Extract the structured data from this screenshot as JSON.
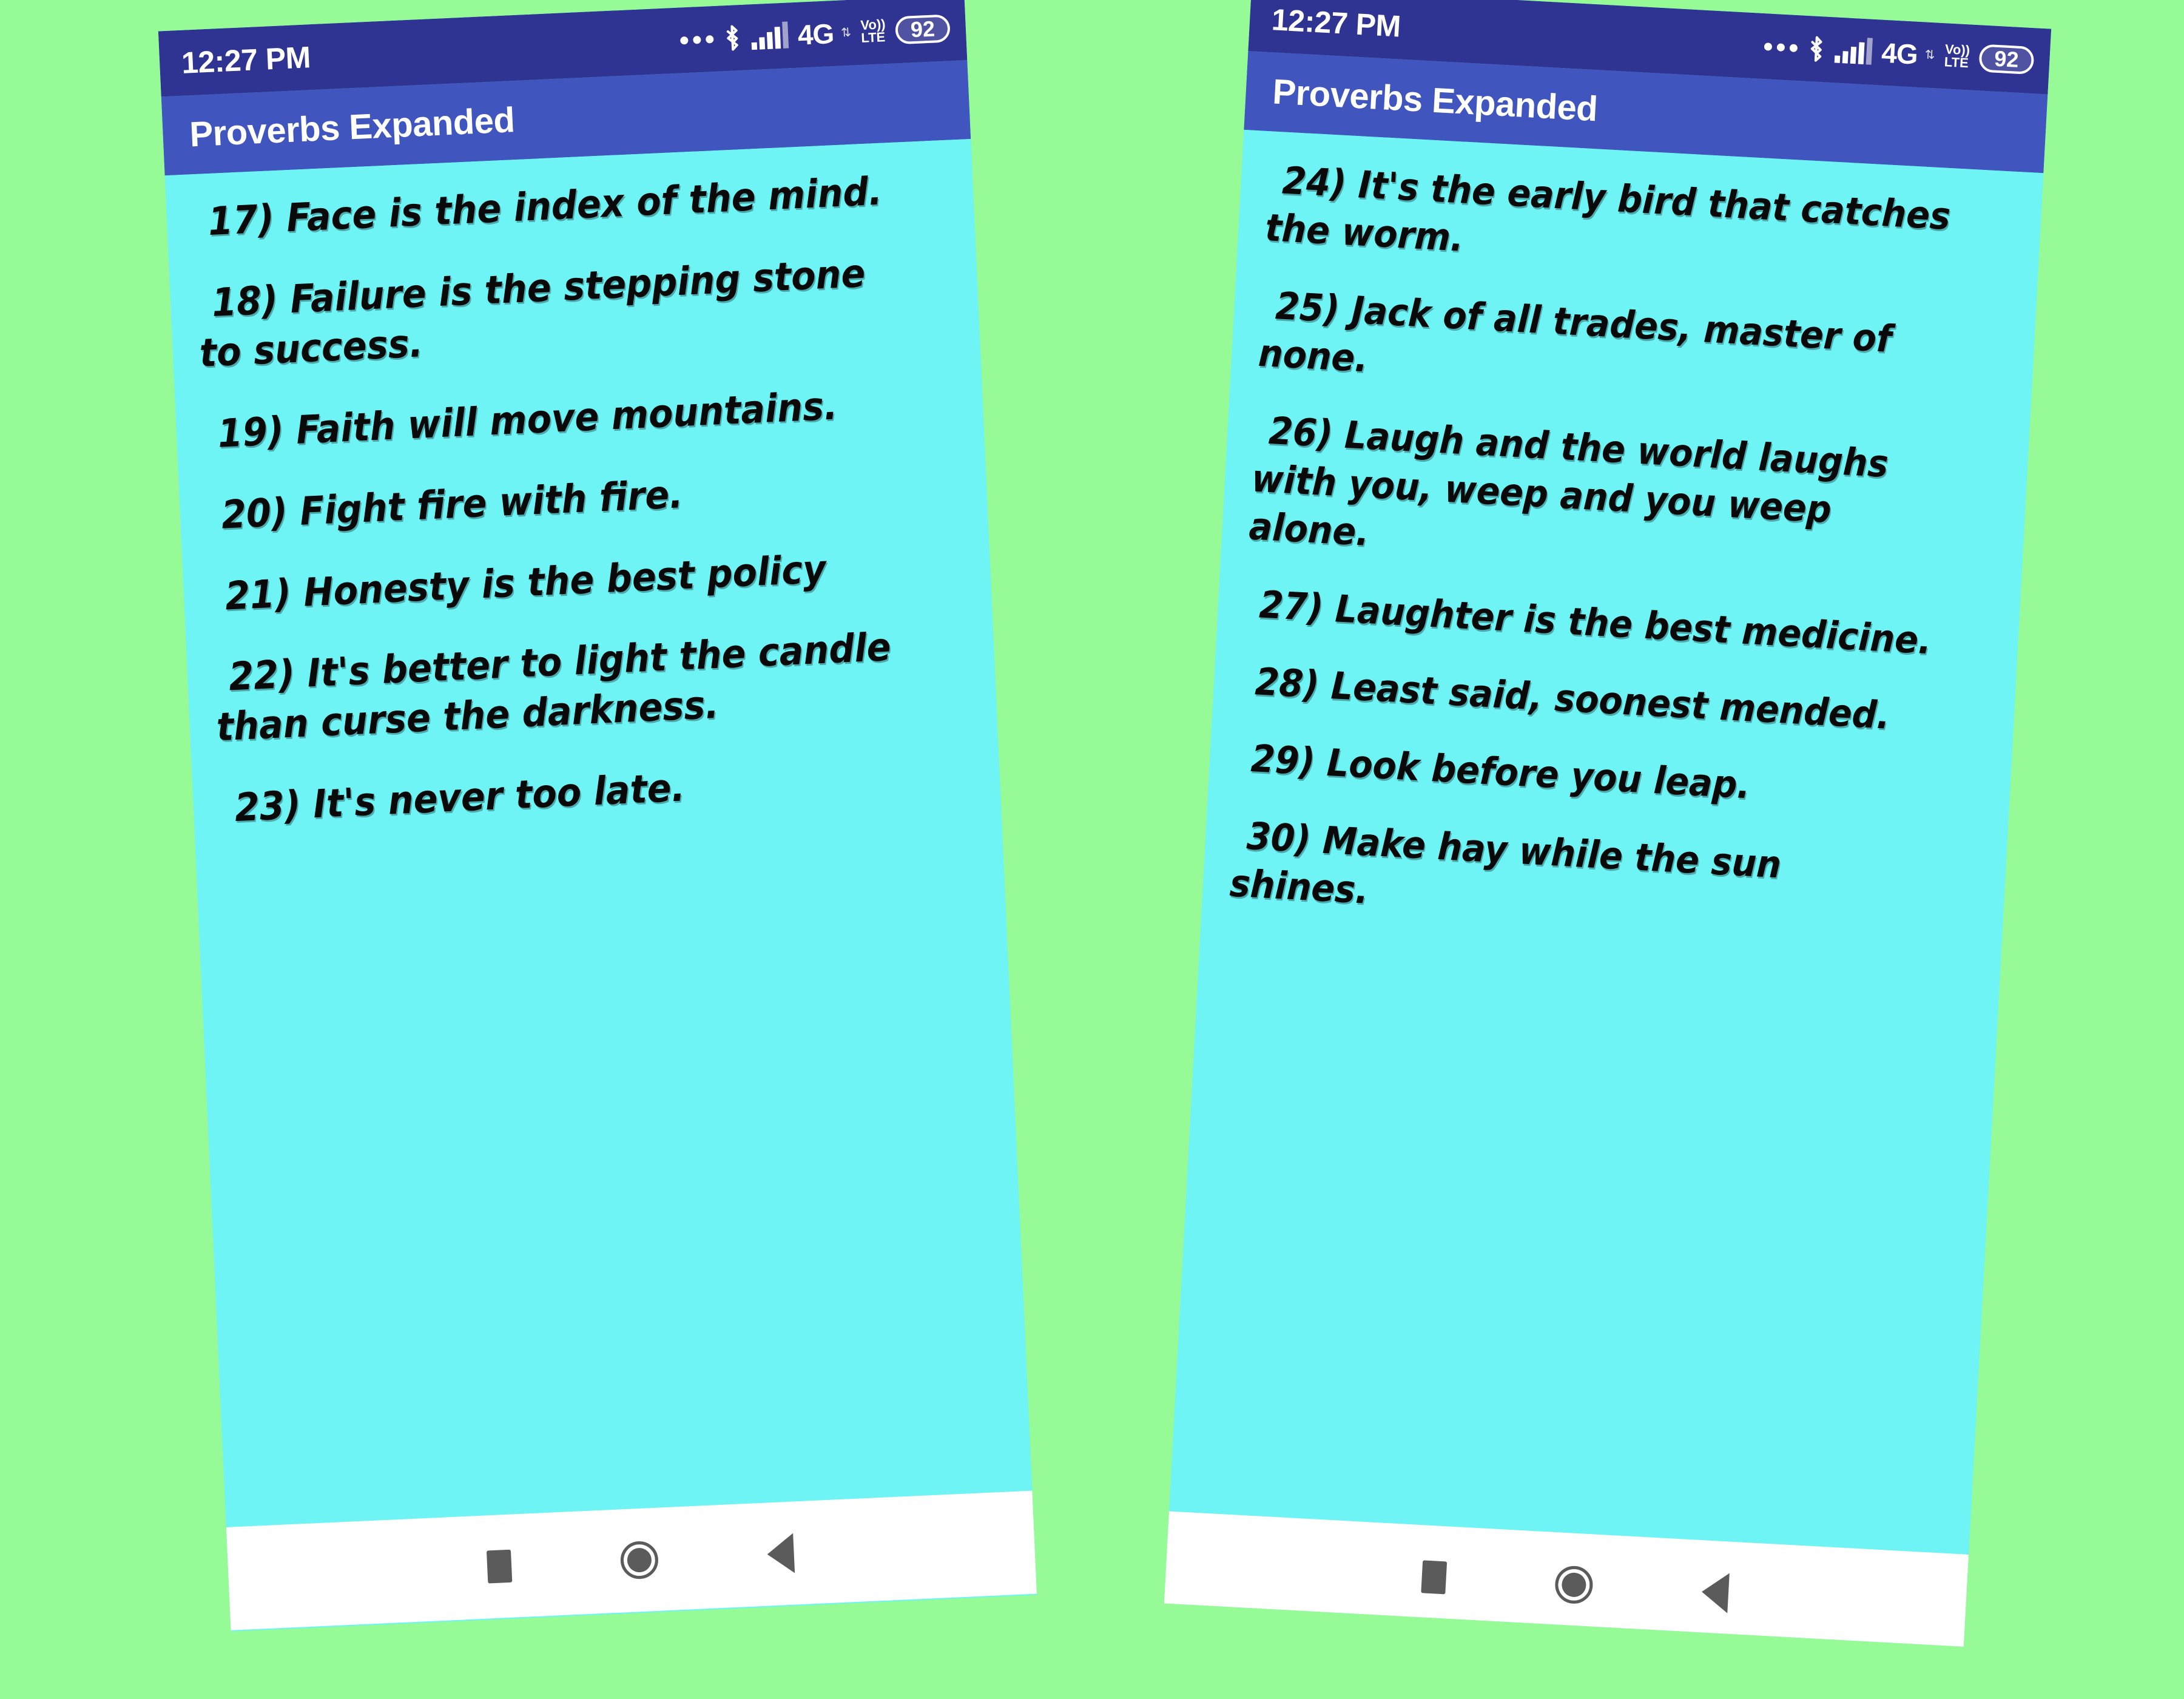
{
  "background_color": "#96fb96",
  "theme": {
    "statusbar_color": "#2f3391",
    "appbar_color": "#4055bd",
    "screen_color": "#6ff4f6",
    "navbar_color": "#ffffff",
    "text_color": "#0a0a0a"
  },
  "phones": [
    {
      "statusbar": {
        "time": "12:27 PM",
        "icons": [
          "more-dots-icon",
          "bluetooth-icon",
          "signal-bars-icon",
          "4g-icon",
          "data-arrows-icon",
          "volte-icon",
          "battery-icon"
        ],
        "network_label": "4G",
        "volte_top": "Vo",
        "volte_bottom": "LTE",
        "battery_level": "92"
      },
      "appbar": {
        "title": "Proverbs Expanded"
      },
      "proverbs": [
        "17) Face is the index of the mind.",
        "18) Failure is the stepping stone to success.",
        "19) Faith will move mountains.",
        "20) Fight fire with fire.",
        "21) Honesty is the best policy",
        "22) It's better to light the candle than curse the darkness.",
        "23) It's never too late."
      ],
      "navbar": {
        "recents_label": "Recents",
        "home_label": "Home",
        "back_label": "Back"
      }
    },
    {
      "statusbar": {
        "time": "12:27 PM",
        "icons": [
          "more-dots-icon",
          "bluetooth-icon",
          "signal-bars-icon",
          "4g-icon",
          "data-arrows-icon",
          "volte-icon",
          "battery-icon"
        ],
        "network_label": "4G",
        "volte_top": "Vo",
        "volte_bottom": "LTE",
        "battery_level": "92"
      },
      "appbar": {
        "title": "Proverbs Expanded"
      },
      "proverbs": [
        "24) It's the early bird that catches the worm.",
        "25) Jack of all trades, master of none.",
        "26) Laugh and the world laughs with you, weep and you weep alone.",
        "27) Laughter is the best medicine.",
        "28) Least said, soonest mended.",
        "29) Look before you leap.",
        "30) Make hay while the sun shines."
      ],
      "navbar": {
        "recents_label": "Recents",
        "home_label": "Home",
        "back_label": "Back"
      }
    }
  ]
}
